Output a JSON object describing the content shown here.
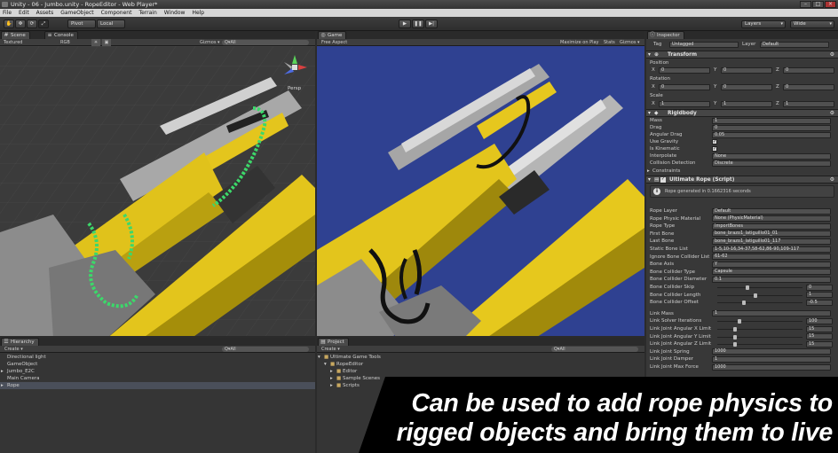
{
  "window": {
    "title": "Unity - 06 - Jumbo.unity - RopeEditor - Web Player*"
  },
  "menu": [
    "File",
    "Edit",
    "Assets",
    "GameObject",
    "Component",
    "Terrain",
    "Window",
    "Help"
  ],
  "toolbar": {
    "pivot": "Pivot",
    "local": "Local",
    "layers": "Layers",
    "layout": "Wide"
  },
  "scene": {
    "tab": "Scene",
    "tab2": "Console",
    "shading": "Textured",
    "render": "RGB",
    "gizmos": "Gizmos ▾",
    "search": "Q▾All",
    "persp": "Persp"
  },
  "game": {
    "tab": "Game",
    "aspect": "Free Aspect",
    "maximize": "Maximize on Play",
    "stats": "Stats",
    "gizmos": "Gizmos ▾"
  },
  "hierarchy": {
    "tab": "Hierarchy",
    "create": "Create ▾",
    "search": "Q▾All",
    "items": [
      "Directional light",
      "GameObject",
      "Jumbo_E2C",
      "Main Camera",
      "Rope"
    ]
  },
  "project": {
    "tab": "Project",
    "create": "Create ▾",
    "search": "Q▾All",
    "items": [
      "Ultimate Game Tools",
      "RopeEditor",
      "Editor",
      "Sample Scenes",
      "Scripts"
    ]
  },
  "inspector": {
    "tab": "Inspector",
    "tag_label": "Tag",
    "tag": "Untagged",
    "layer_label": "Layer",
    "layer": "Default",
    "transform": {
      "title": "Transform",
      "position": "Position",
      "rotation": "Rotation",
      "scale": "Scale",
      "pos": [
        "0",
        "0",
        "0"
      ],
      "rot": [
        "0",
        "0",
        "0"
      ],
      "scl": [
        "1",
        "1",
        "1"
      ]
    },
    "rigidbody": {
      "title": "Rigidbody",
      "rows": [
        {
          "label": "Mass",
          "value": "1"
        },
        {
          "label": "Drag",
          "value": "0"
        },
        {
          "label": "Angular Drag",
          "value": "0.05"
        },
        {
          "label": "Use Gravity",
          "value": "✓"
        },
        {
          "label": "Is Kinematic",
          "value": "✓"
        },
        {
          "label": "Interpolate",
          "value": "None"
        },
        {
          "label": "Collision Detection",
          "value": "Discrete"
        }
      ],
      "constraints": "Constraints"
    },
    "rope": {
      "title": "Ultimate Rope (Script)",
      "info": "Rope generated in 0.1662316 seconds",
      "rows": [
        {
          "label": "Rope Layer",
          "value": "Default"
        },
        {
          "label": "Rope Physic Material",
          "value": "None (PhysicMaterial)"
        },
        {
          "label": "Rope Type",
          "value": "ImportBones"
        },
        {
          "label": "First Bone",
          "value": "bone_brazo1_latiguillo01_01"
        },
        {
          "label": "Last Bone",
          "value": "bone_brazo1_latiguillo01_117"
        },
        {
          "label": "Static Bone List",
          "value": "1-5,10-16,34-37,58-62,86-90,109-117"
        },
        {
          "label": "Ignore Bone Collider List",
          "value": "61-62"
        },
        {
          "label": "Bone Axis",
          "value": "Y"
        },
        {
          "label": "Bone Collider Type",
          "value": "Capsule"
        },
        {
          "label": "Bone Collider Diameter",
          "value": "0.1"
        },
        {
          "label": "Bone Collider Skip",
          "value": "0"
        },
        {
          "label": "Bone Collider Length",
          "value": "1"
        },
        {
          "label": "Bone Collider Offset",
          "value": "-0.5"
        },
        {
          "label": "Link Mass",
          "value": "1"
        },
        {
          "label": "Link Solver Iterations",
          "value": "100"
        },
        {
          "label": "Link Joint Angular X Limit",
          "value": "15"
        },
        {
          "label": "Link Joint Angular Y Limit",
          "value": "15"
        },
        {
          "label": "Link Joint Angular Z Limit",
          "value": "15"
        },
        {
          "label": "Link Joint Spring",
          "value": "1000"
        },
        {
          "label": "Link Joint Damper",
          "value": "1"
        },
        {
          "label": "Link Joint Max Force",
          "value": "1000"
        }
      ]
    }
  },
  "caption": {
    "line1": "Can be used to add rope physics to",
    "line2": "rigged objects and bring them to live"
  }
}
